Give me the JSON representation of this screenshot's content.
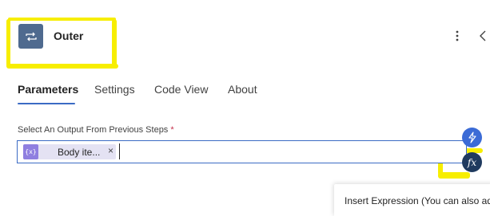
{
  "header": {
    "title": "Outer",
    "app_icon": "loop-icon",
    "more_icon": "more-vertical-icon",
    "collapse_icon": "chevron-left-icon"
  },
  "tabs": [
    {
      "label": "Parameters",
      "active": true
    },
    {
      "label": "Settings",
      "active": false
    },
    {
      "label": "Code View",
      "active": false
    },
    {
      "label": "About",
      "active": false
    }
  ],
  "field": {
    "label": "Select An Output From Previous Steps",
    "required_mark": "*",
    "token": {
      "icon_text": "{x}",
      "label": "Body ite...",
      "remove": "×"
    }
  },
  "side_buttons": {
    "dynamic_content_icon": "lightning-icon",
    "expression_label": "fx"
  },
  "tooltip": {
    "text": "Insert Expression (You can also add"
  },
  "colors": {
    "accent": "#3b6bc4",
    "app_icon_bg": "#4f6a8f",
    "token_bg": "#e4e2f3",
    "token_icon_bg": "#8f7fe0",
    "highlight": "#f7ee00"
  }
}
